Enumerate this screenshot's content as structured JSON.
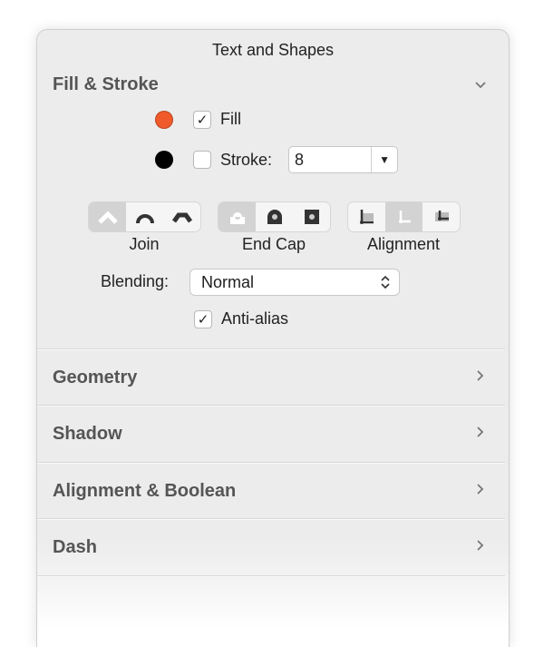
{
  "panel": {
    "title": "Text and Shapes"
  },
  "fill_stroke": {
    "header": "Fill & Stroke",
    "expanded": true,
    "fill": {
      "label": "Fill",
      "checked": true,
      "color": "#f05a2a"
    },
    "stroke": {
      "label": "Stroke:",
      "checked": false,
      "color": "#000000",
      "width_value": "8"
    },
    "join": {
      "label": "Join",
      "options": [
        "miter-join",
        "round-join",
        "bevel-join"
      ],
      "selected": 0
    },
    "end_cap": {
      "label": "End Cap",
      "options": [
        "butt-cap",
        "round-cap",
        "square-cap"
      ],
      "selected": 0
    },
    "alignment": {
      "label": "Alignment",
      "options": [
        "inside",
        "center",
        "outside"
      ],
      "selected": 1
    },
    "blending": {
      "label": "Blending:",
      "value": "Normal"
    },
    "anti_alias": {
      "label": "Anti-alias",
      "checked": true
    }
  },
  "sections": [
    {
      "header": "Geometry",
      "expanded": false
    },
    {
      "header": "Shadow",
      "expanded": false
    },
    {
      "header": "Alignment & Boolean",
      "expanded": false
    },
    {
      "header": "Dash",
      "expanded": false
    }
  ],
  "glyphs": {
    "check": "✓",
    "dropdown": "▼"
  }
}
